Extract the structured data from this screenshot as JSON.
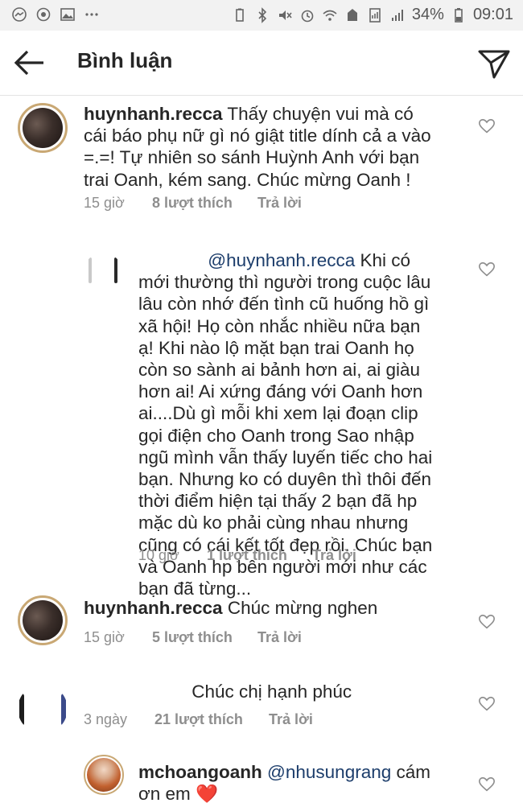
{
  "status_bar": {
    "battery": "34%",
    "time": "09:01"
  },
  "header": {
    "title": "Bình luận"
  },
  "comments": [
    {
      "username": "huynhanh.recca",
      "text": "Thấy chuyện vui mà có cái báo phụ nữ gì nó giật title dính cả a vào =.=! Tự nhiên so sánh Huỳnh Anh với bạn trai Oanh, kém sang. Chúc mừng Oanh !",
      "time": "15 giờ",
      "likes": "8 lượt thích",
      "reply": "Trả lời"
    },
    {
      "username": "",
      "mention": "@huynhanh.recca",
      "text": " Khi có mới thường thì người trong cuộc lâu lâu còn nhớ đến tình cũ huống hồ gì xã hội! Họ còn nhắc nhiều nữa bạn ạ! Khi nào lộ mặt bạn trai Oanh họ còn so sành ai bảnh hơn ai, ai giàu hơn ai! Ai xứng đáng với Oanh hơn ai....Dù gì mỗi khi xem lại đoạn clip gọi điện cho Oanh trong Sao nhập ngũ mình vẫn thấy luyến tiếc cho hai bạn. Nhưng ko có duyên thì thôi đến thời điểm hiện tại thấy 2 bạn đã hp mặc dù ko phải cùng nhau nhưng cũng có cái kết tốt đẹp rồi. Chúc bạn và Oanh hp bên người mới như các bạn đã từng...",
      "time": "10 giờ",
      "likes": "1 lượt thích",
      "reply": "Trả lời"
    },
    {
      "username": "huynhanh.recca",
      "text": "Chúc mừng nghen",
      "time": "15 giờ",
      "likes": "5 lượt thích",
      "reply": "Trả lời"
    },
    {
      "username": "",
      "text": "Chúc chị hạnh phúc",
      "time": "3 ngày",
      "likes": "21 lượt thích",
      "reply": "Trả lời"
    },
    {
      "username": "mchoangoanh",
      "mention": "@nhusungrang",
      "text": " cám ơn em",
      "emoji": "❤️"
    }
  ]
}
